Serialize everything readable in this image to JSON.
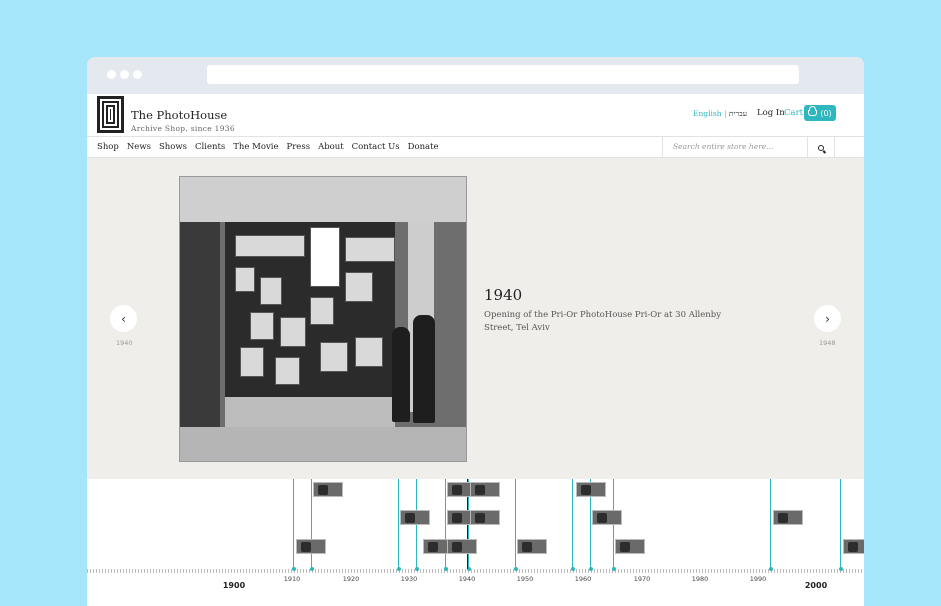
{
  "site": {
    "title": "The PhotoHouse",
    "subtitle": "Archive Shop, since 1936"
  },
  "header": {
    "lang_english": "English",
    "lang_sep": "|",
    "lang_hebrew": "עברית",
    "login": "Log In",
    "cart_label": "Cart",
    "cart_count": "(0)"
  },
  "nav": {
    "items": [
      "Shop",
      "News",
      "Shows",
      "Clients",
      "The Movie",
      "Press",
      "About",
      "Contact Us",
      "Donate"
    ]
  },
  "search": {
    "placeholder": "Search entire store here..."
  },
  "slide": {
    "year": "1940",
    "description": "Opening of the Pri-Or PhotoHouse Pri-Or at 30 Allenby Street, Tel Aviv",
    "prev_year": "1940",
    "next_year": "1948"
  },
  "timeline": {
    "centuries": [
      "1900",
      "2000"
    ],
    "decades": [
      "1910",
      "1920",
      "1930",
      "1940",
      "1950",
      "1960",
      "1970",
      "1980",
      "1990"
    ]
  },
  "colors": {
    "accent": "#2eb7bf",
    "background": "#a5e6fb",
    "slider_bg": "#efeeea"
  }
}
